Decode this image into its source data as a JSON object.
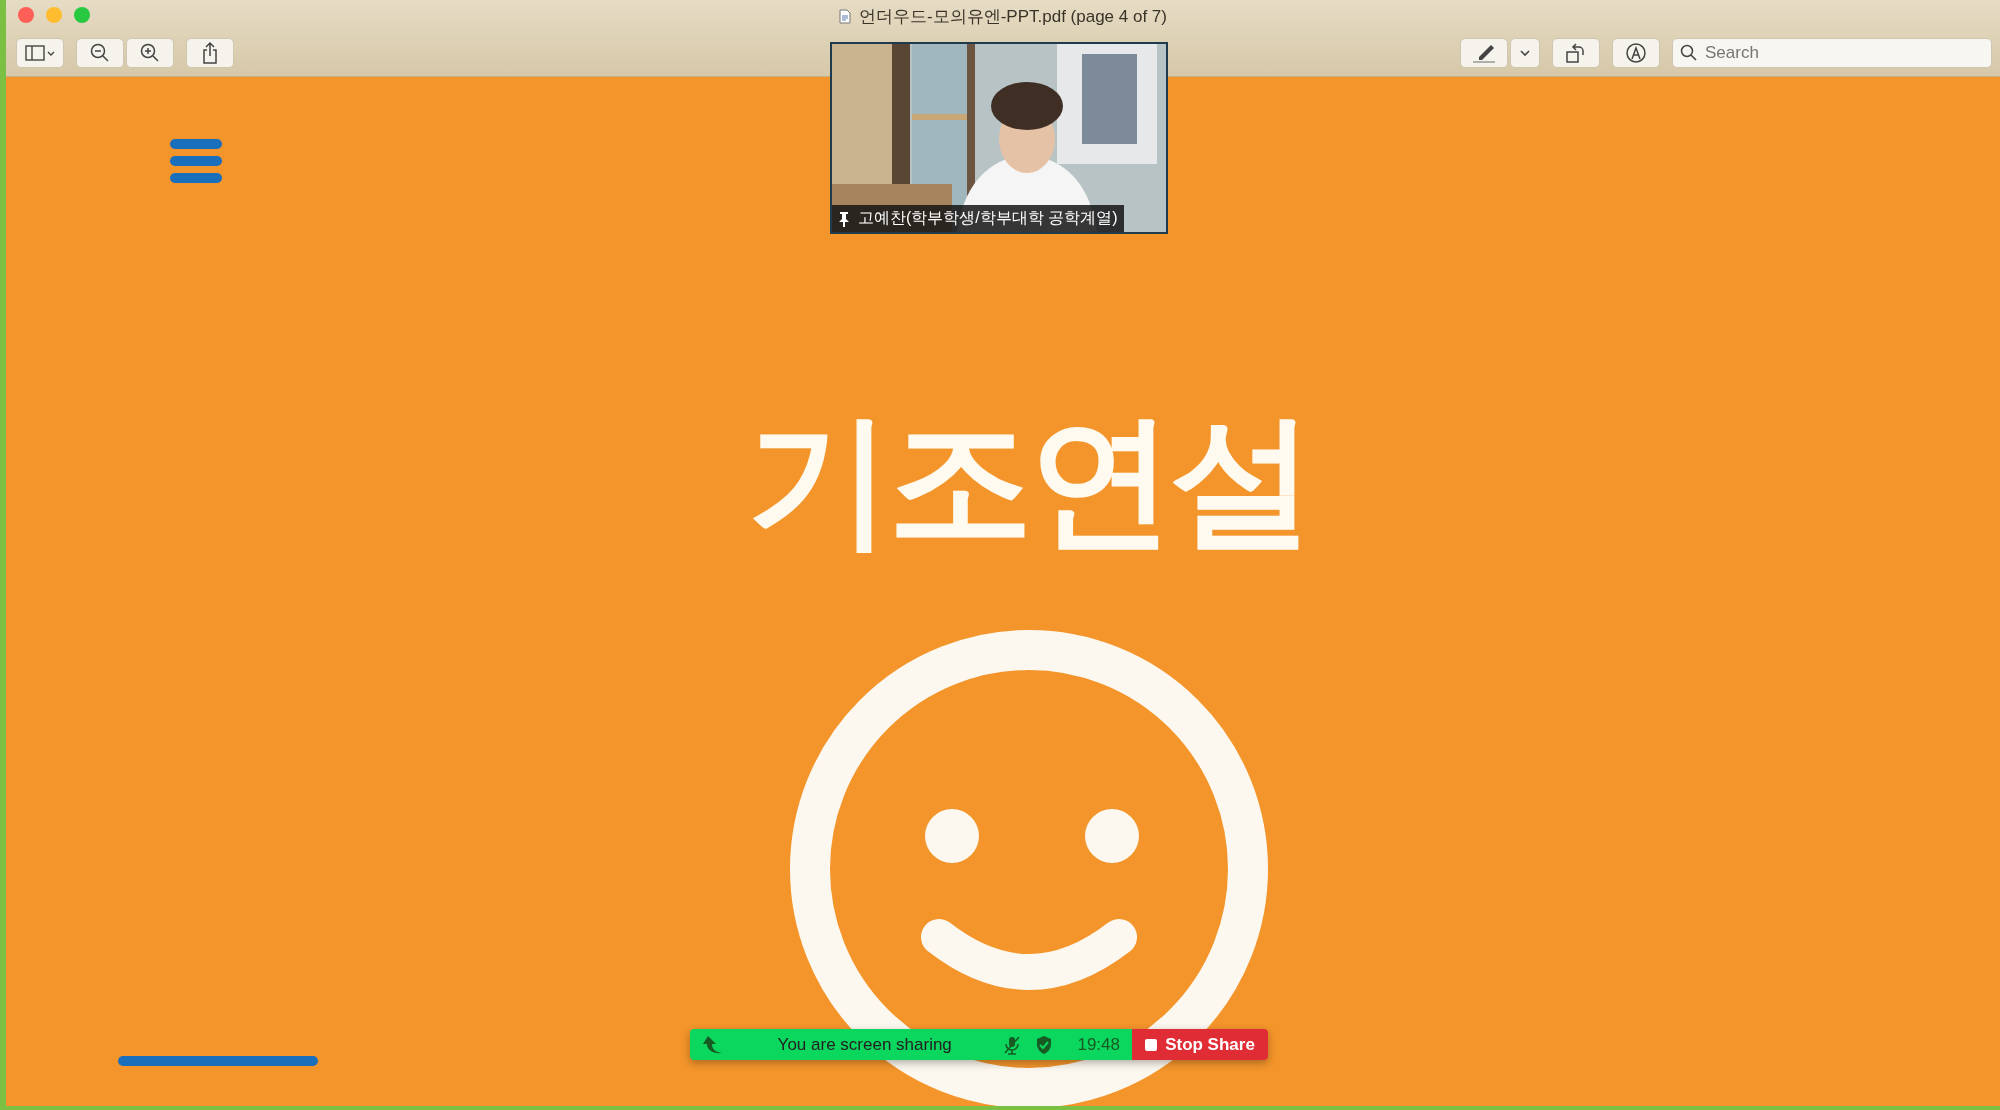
{
  "window": {
    "title": "언더우드-모의유엔-PPT.pdf (page 4 of 7)"
  },
  "toolbar": {
    "search": {
      "placeholder": "Search"
    }
  },
  "slide": {
    "title": "기조연설"
  },
  "video": {
    "kind": "picture",
    "participant": "고예찬(학부학생/학부대학 공학계열)"
  },
  "share_bar": {
    "status": "You are screen sharing",
    "time": "19:48",
    "stop_button": "Stop Share"
  }
}
